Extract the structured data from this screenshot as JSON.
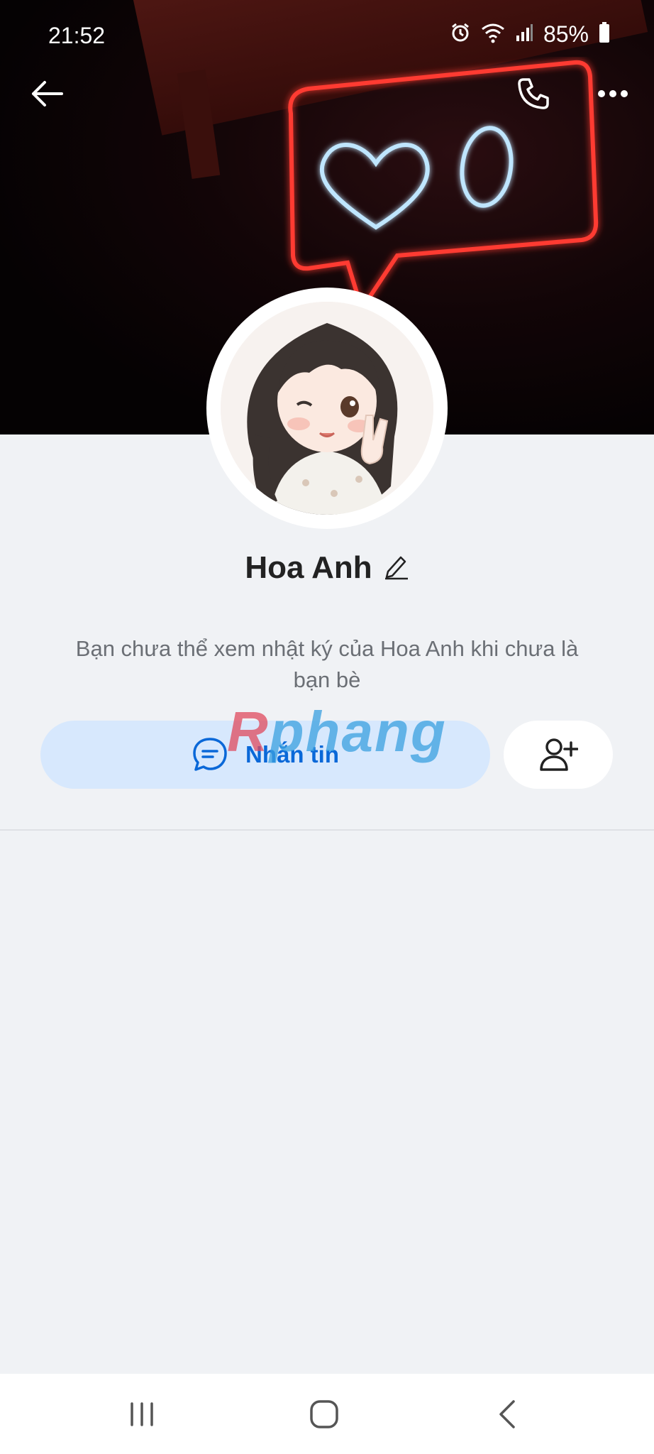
{
  "status": {
    "time": "21:52",
    "battery": "85%"
  },
  "profile": {
    "name": "Hoa Anh",
    "notice": "Bạn chưa thể xem nhật ký của Hoa Anh khi chưa là bạn bè"
  },
  "actions": {
    "message_label": "Nhắn tin"
  },
  "watermark": {
    "first": "R",
    "rest": "phang"
  },
  "colors": {
    "accent": "#0a68d8",
    "button_bg": "#d7e8fd",
    "background": "#f0f2f5"
  },
  "icons": {
    "back": "back-arrow-icon",
    "call": "phone-icon",
    "more": "more-icon",
    "edit": "pencil-icon",
    "chat": "chat-bubble-icon",
    "add_friend": "add-friend-icon"
  }
}
